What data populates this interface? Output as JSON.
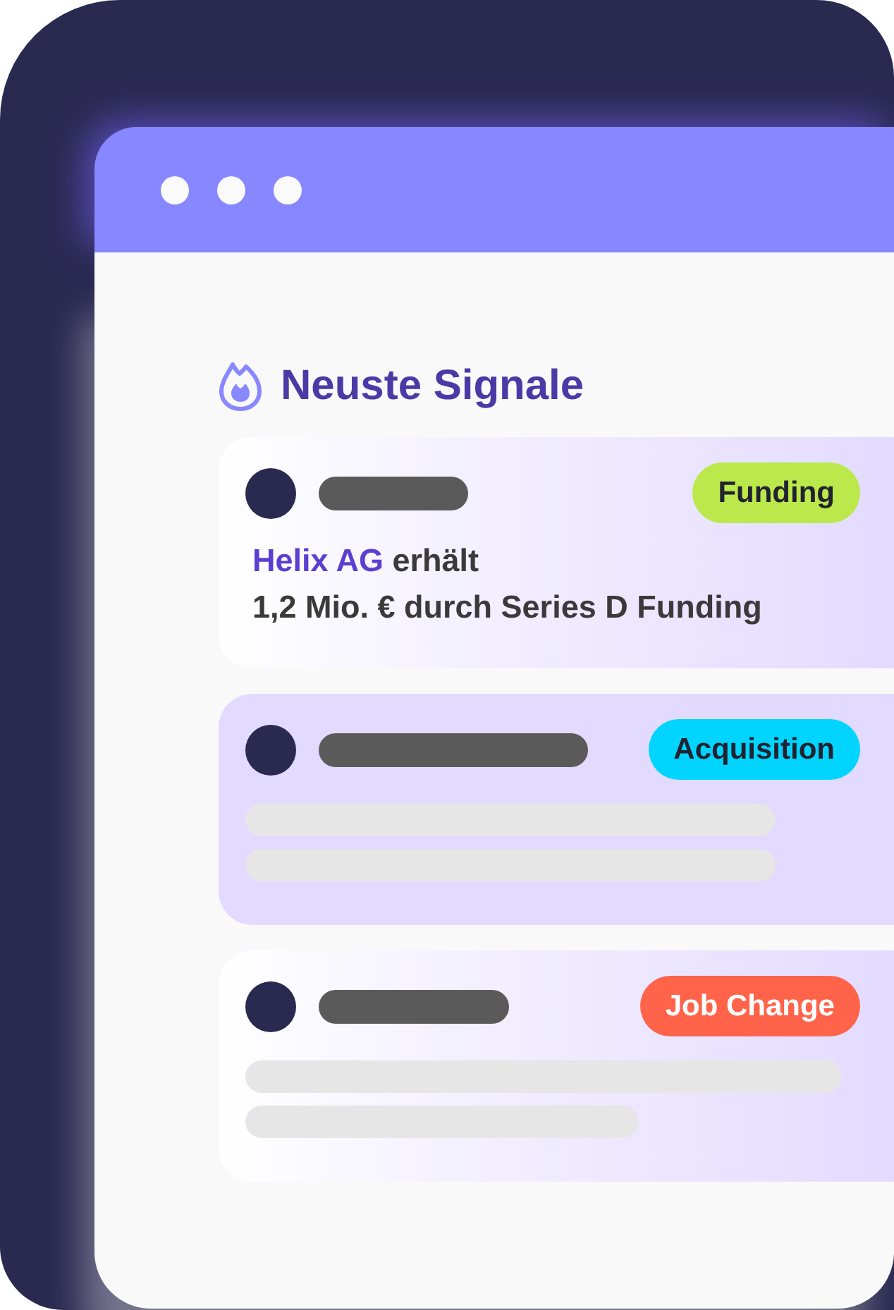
{
  "section": {
    "title": "Neuste Signale"
  },
  "signals": [
    {
      "kind": "message",
      "tag": "Funding",
      "color": "#bbe84a",
      "selected": false,
      "company": "Helix AG",
      "text": "erhält",
      "detail": "1,2 Mio. € durch Series D Funding"
    },
    {
      "kind": "skeleton",
      "tag": "Acquisition",
      "color": "#00d4ff",
      "selected": true
    },
    {
      "kind": "skeleton",
      "tag": "Job Change",
      "color": "#ff644a",
      "selected": false
    }
  ]
}
